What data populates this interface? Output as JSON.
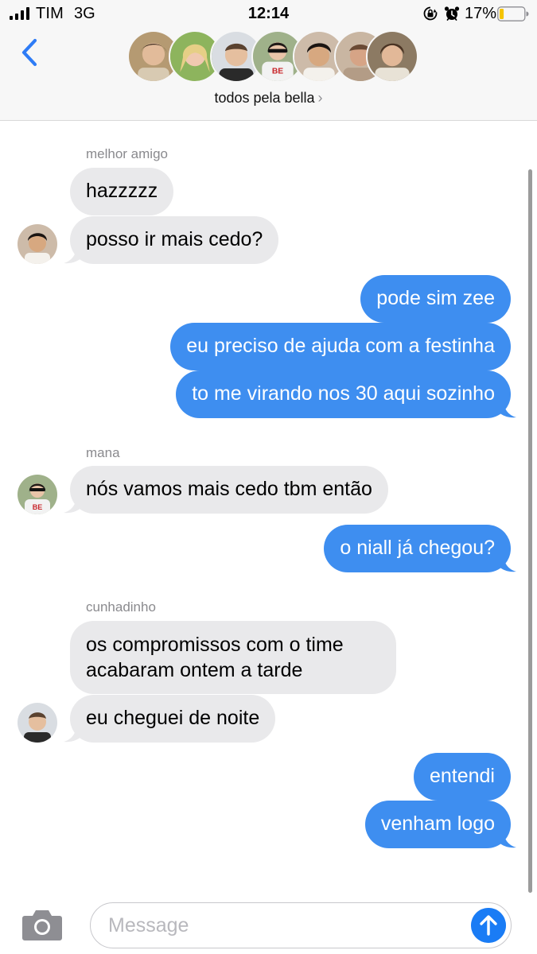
{
  "status_bar": {
    "carrier": "TIM",
    "network": "3G",
    "time": "12:14",
    "battery_percent": "17%",
    "battery_level": 0.17,
    "icons": [
      "signal-icon",
      "orientation-lock-icon",
      "alarm-icon",
      "battery-icon"
    ]
  },
  "header": {
    "group_name": "todos pela bella",
    "chevron": "›",
    "back_icon": "chevron-left-icon",
    "participant_count": 7
  },
  "messages": [
    {
      "sender": "melhor amigo",
      "direction": "in",
      "text": "hazzzzz"
    },
    {
      "direction": "in",
      "text": "posso ir mais cedo?"
    },
    {
      "direction": "out",
      "text": "pode sim zee"
    },
    {
      "direction": "out",
      "text": "eu preciso de ajuda com a festinha"
    },
    {
      "direction": "out",
      "text": "to me virando nos 30 aqui sozinho"
    },
    {
      "sender": "mana",
      "direction": "in",
      "text": "nós vamos mais cedo tbm então"
    },
    {
      "direction": "out",
      "text": "o niall já chegou?"
    },
    {
      "sender": "cunhadinho",
      "direction": "in",
      "text": "os compromissos com o time acabaram ontem a tarde"
    },
    {
      "direction": "in",
      "text": "eu cheguei de noite"
    },
    {
      "direction": "out",
      "text": "entendi"
    },
    {
      "direction": "out",
      "text": "venham logo"
    }
  ],
  "input": {
    "placeholder": "Message",
    "camera_icon": "camera-icon",
    "send_icon": "arrow-up-icon"
  },
  "colors": {
    "outgoing_bubble": "#3e8ef0",
    "incoming_bubble": "#e9e9eb",
    "accent": "#1a7cf5",
    "bar_background": "#f7f7f7"
  }
}
